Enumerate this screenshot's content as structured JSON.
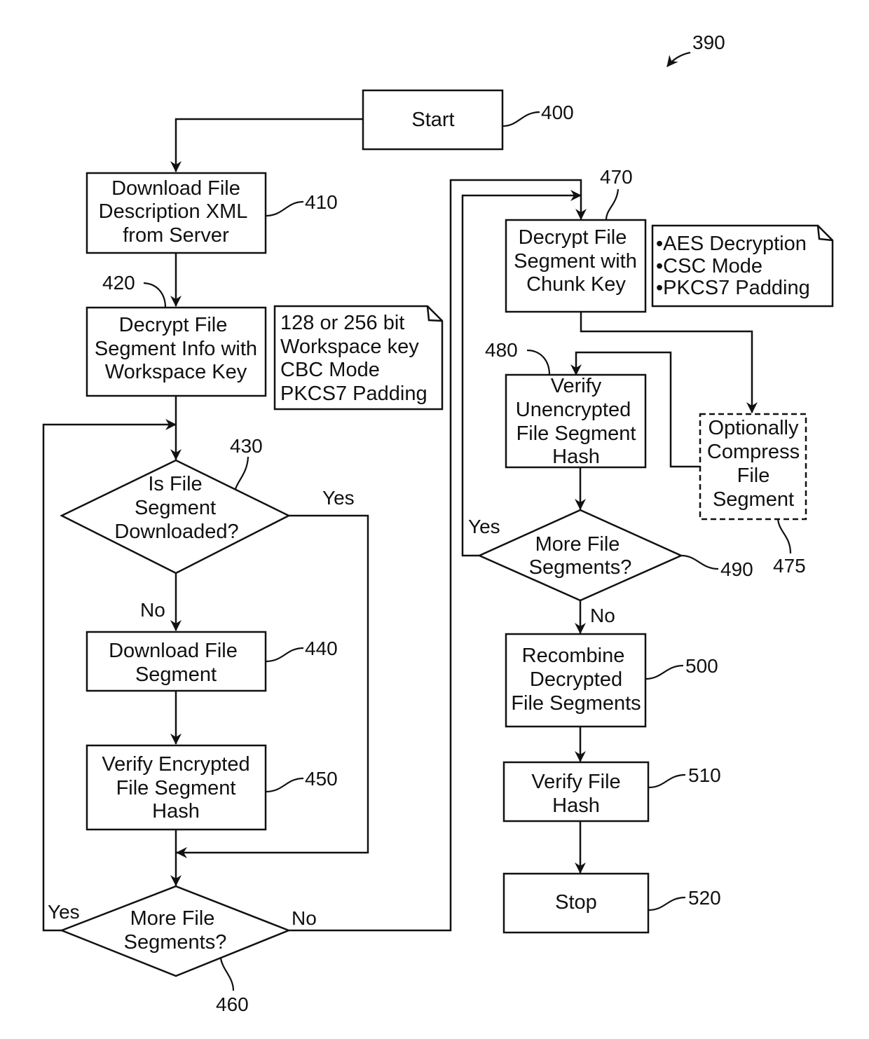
{
  "figure_ref": "390",
  "nodes": {
    "start": {
      "ref": "400",
      "lines": [
        "Start"
      ]
    },
    "download_xml": {
      "ref": "410",
      "lines": [
        "Download File",
        "Description XML",
        "from Server"
      ]
    },
    "decrypt_info": {
      "ref": "420",
      "lines": [
        "Decrypt File",
        "Segment Info with",
        "Workspace Key"
      ]
    },
    "is_downloaded": {
      "ref": "430",
      "lines": [
        "Is File",
        "Segment",
        "Downloaded?"
      ]
    },
    "download_segment": {
      "ref": "440",
      "lines": [
        "Download File",
        "Segment"
      ]
    },
    "verify_encrypted": {
      "ref": "450",
      "lines": [
        "Verify Encrypted",
        "File Segment",
        "Hash"
      ]
    },
    "more_segments_left": {
      "ref": "460",
      "lines": [
        "More File",
        "Segments?"
      ]
    },
    "decrypt_chunk": {
      "ref": "470",
      "lines": [
        "Decrypt File",
        "Segment with",
        "Chunk Key"
      ]
    },
    "compress": {
      "ref": "475",
      "lines": [
        "Optionally",
        "Compress",
        "File",
        "Segment"
      ]
    },
    "verify_unencrypted": {
      "ref": "480",
      "lines": [
        "Verify",
        "Unencrypted",
        "File Segment",
        "Hash"
      ]
    },
    "more_segments_right": {
      "ref": "490",
      "lines": [
        "More File",
        "Segments?"
      ]
    },
    "recombine": {
      "ref": "500",
      "lines": [
        "Recombine",
        "Decrypted",
        "File Segments"
      ]
    },
    "verify_file_hash": {
      "ref": "510",
      "lines": [
        "Verify File",
        "Hash"
      ]
    },
    "stop": {
      "ref": "520",
      "lines": [
        "Stop"
      ]
    }
  },
  "notes": {
    "workspace_key_note": {
      "lines": [
        "128 or 256 bit",
        "Workspace key",
        "CBC Mode",
        "PKCS7 Padding"
      ]
    },
    "chunk_key_note": {
      "lines": [
        "•AES Decryption",
        "•CSC Mode",
        "•PKCS7 Padding"
      ]
    }
  },
  "edge_labels": {
    "is_downloaded_yes": "Yes",
    "is_downloaded_no": "No",
    "more_left_yes": "Yes",
    "more_left_no": "No",
    "more_right_yes": "Yes",
    "more_right_no": "No"
  }
}
